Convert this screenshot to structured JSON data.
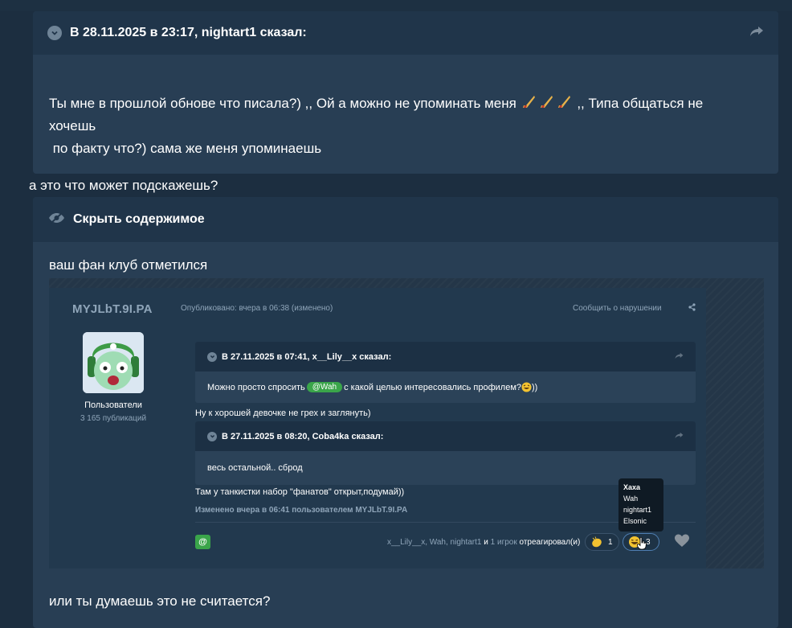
{
  "quote1": {
    "title": "В 28.11.2025 в 23:17, nightart1 сказал:",
    "line1a": "Ты мне в прошлой обнове что писала?) ,, Ой а можно не упоминать меня",
    "line1b": ",, Типа общаться не",
    "line2": "хочешь",
    "line3": " по факту что?) сама же меня упоминаешь"
  },
  "standalone_line": "а это что может подскажешь?",
  "spoiler": {
    "title": "Скрыть содержимое",
    "text_before": "ваш фан клуб отметился",
    "text_after": "или ты думаешь это не считается?"
  },
  "screenshot": {
    "username": "MYJLbT.9I.PA",
    "published": "Опубликовано: вчера в 06:38 (изменено)",
    "report": "Сообщить о нарушении",
    "group": "Пользователи",
    "publications": "3 165 публикаций",
    "quote_a": {
      "title": "В 27.11.2025 в 07:41, x__Lily__x сказал:",
      "text_before": "Можно просто спросить",
      "mention": "@Wah",
      "text_after": "с какой целью интересовались профилем?",
      "text_end": "))"
    },
    "line_between": "Ну к хорошей девочке не грех и заглянуть)",
    "quote_b": {
      "title": "В 27.11.2025 в 08:20, Coba4ka сказал:",
      "text": "весь остальной.. сброд"
    },
    "line_after": "Там у танкистки набор \"фанатов\" открыт,подумай))",
    "edited": "Изменено вчера в 06:41 пользователем MYJLbT.9I.PA",
    "at_label": "@",
    "reacted_names": "x__Lily__x, Wah, nightart1",
    "reacted_and": "и",
    "reacted_more": "1 игрок",
    "reacted_suffix": "отреагировал(и)",
    "reaction_clap_count": "1",
    "reaction_laugh_count": "3",
    "tooltip": {
      "heading": "Хаха",
      "names": [
        "Wah",
        "nightart1",
        "Elsonic"
      ]
    }
  },
  "colors": {
    "page_bg": "#1c2e40",
    "quote_bg": "#283e54",
    "quote_header_bg": "#20354a",
    "accent_green": "#3aa54a",
    "muted_text": "#8fa5b9"
  }
}
